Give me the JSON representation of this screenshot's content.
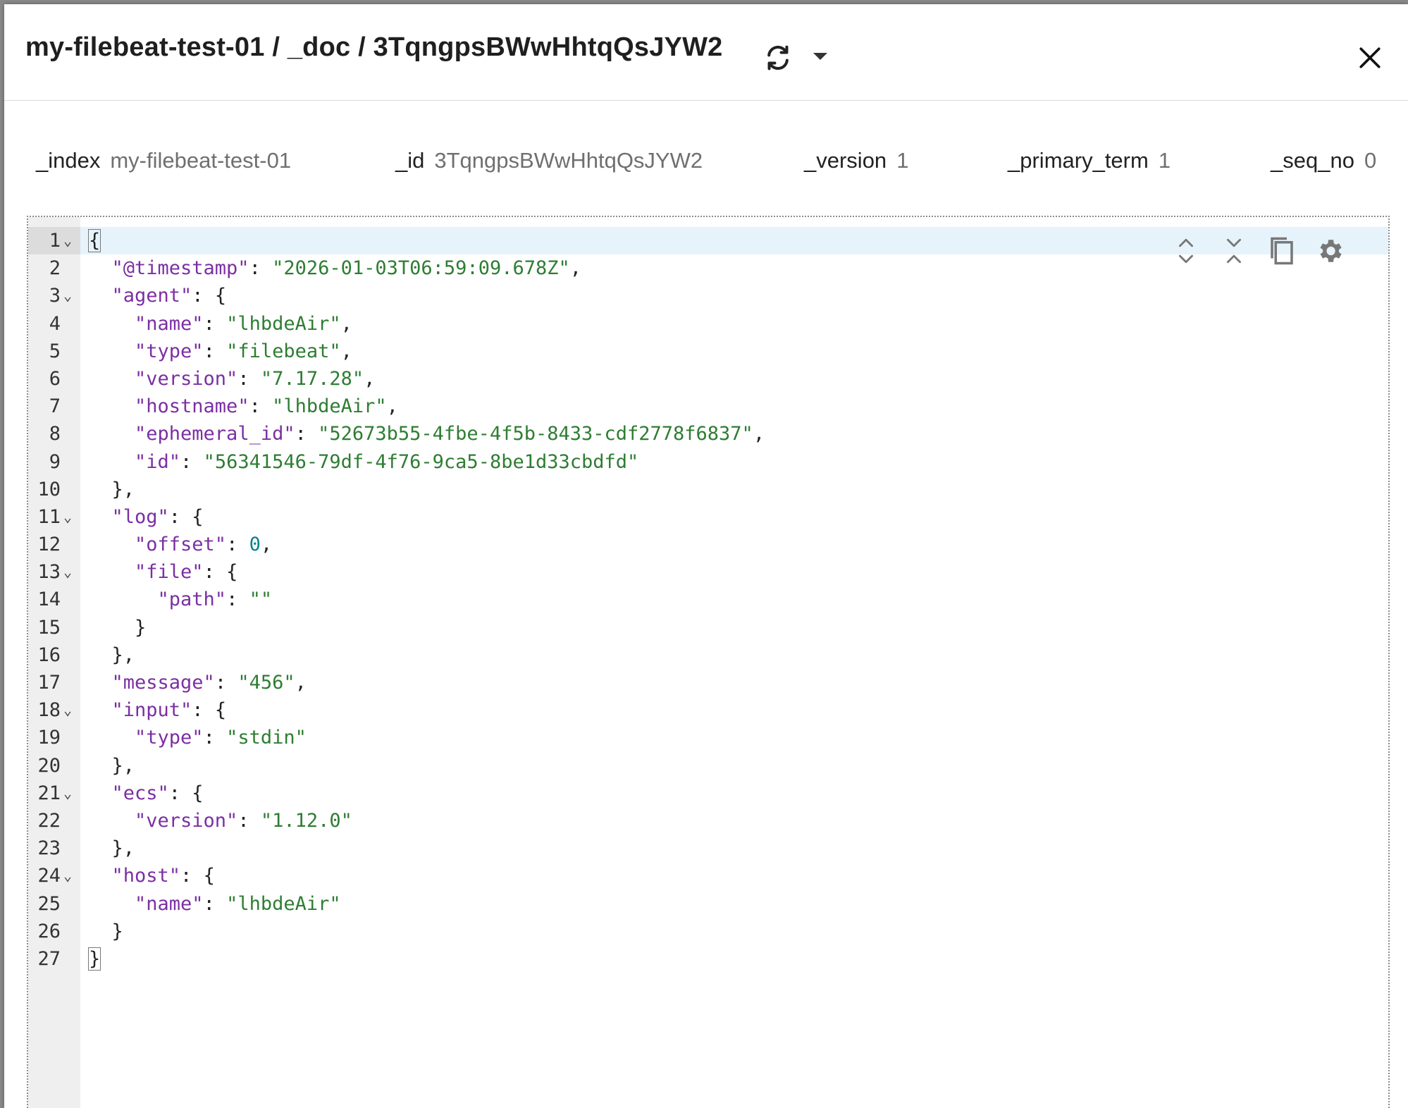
{
  "header": {
    "title": "my-filebeat-test-01 / _doc / 3TqngpsBWwHhtqQsJYW2",
    "refresh_icon": "refresh-icon",
    "dropdown_icon": "caret-down-icon",
    "close_icon": "close-icon"
  },
  "meta": [
    {
      "key": "_index",
      "value": "my-filebeat-test-01"
    },
    {
      "key": "_id",
      "value": "3TqngpsBWwHhtqQsJYW2"
    },
    {
      "key": "_version",
      "value": "1"
    },
    {
      "key": "_primary_term",
      "value": "1"
    },
    {
      "key": "_seq_no",
      "value": "0"
    }
  ],
  "editor": {
    "toolbar_icons": [
      "expand-all-icon",
      "collapse-all-icon",
      "copy-icon",
      "settings-icon"
    ],
    "colors": {
      "key": "#7b2fa3",
      "string": "#2e7d32",
      "number": "#00838f"
    },
    "lines": [
      {
        "n": "1",
        "fold": true,
        "indent": 0,
        "key": "",
        "sep": "",
        "val": "",
        "type": "",
        "tail": "{"
      },
      {
        "n": "2",
        "fold": false,
        "indent": 1,
        "key": "\"@timestamp\"",
        "sep": ": ",
        "val": "\"2026-01-03T06:59:09.678Z\"",
        "type": "s",
        "tail": ","
      },
      {
        "n": "3",
        "fold": true,
        "indent": 1,
        "key": "\"agent\"",
        "sep": ": ",
        "val": "",
        "type": "",
        "tail": "{"
      },
      {
        "n": "4",
        "fold": false,
        "indent": 2,
        "key": "\"name\"",
        "sep": ": ",
        "val": "\"lhbdeAir\"",
        "type": "s",
        "tail": ","
      },
      {
        "n": "5",
        "fold": false,
        "indent": 2,
        "key": "\"type\"",
        "sep": ": ",
        "val": "\"filebeat\"",
        "type": "s",
        "tail": ","
      },
      {
        "n": "6",
        "fold": false,
        "indent": 2,
        "key": "\"version\"",
        "sep": ": ",
        "val": "\"7.17.28\"",
        "type": "s",
        "tail": ","
      },
      {
        "n": "7",
        "fold": false,
        "indent": 2,
        "key": "\"hostname\"",
        "sep": ": ",
        "val": "\"lhbdeAir\"",
        "type": "s",
        "tail": ","
      },
      {
        "n": "8",
        "fold": false,
        "indent": 2,
        "key": "\"ephemeral_id\"",
        "sep": ": ",
        "val": "\"52673b55-4fbe-4f5b-8433-cdf2778f6837\"",
        "type": "s",
        "tail": ","
      },
      {
        "n": "9",
        "fold": false,
        "indent": 2,
        "key": "\"id\"",
        "sep": ": ",
        "val": "\"56341546-79df-4f76-9ca5-8be1d33cbdfd\"",
        "type": "s",
        "tail": ""
      },
      {
        "n": "10",
        "fold": false,
        "indent": 1,
        "key": "",
        "sep": "",
        "val": "",
        "type": "",
        "tail": "},"
      },
      {
        "n": "11",
        "fold": true,
        "indent": 1,
        "key": "\"log\"",
        "sep": ": ",
        "val": "",
        "type": "",
        "tail": "{"
      },
      {
        "n": "12",
        "fold": false,
        "indent": 2,
        "key": "\"offset\"",
        "sep": ": ",
        "val": "0",
        "type": "n",
        "tail": ","
      },
      {
        "n": "13",
        "fold": true,
        "indent": 2,
        "key": "\"file\"",
        "sep": ": ",
        "val": "",
        "type": "",
        "tail": "{"
      },
      {
        "n": "14",
        "fold": false,
        "indent": 3,
        "key": "\"path\"",
        "sep": ": ",
        "val": "\"\"",
        "type": "s",
        "tail": ""
      },
      {
        "n": "15",
        "fold": false,
        "indent": 2,
        "key": "",
        "sep": "",
        "val": "",
        "type": "",
        "tail": "}"
      },
      {
        "n": "16",
        "fold": false,
        "indent": 1,
        "key": "",
        "sep": "",
        "val": "",
        "type": "",
        "tail": "},"
      },
      {
        "n": "17",
        "fold": false,
        "indent": 1,
        "key": "\"message\"",
        "sep": ": ",
        "val": "\"456\"",
        "type": "s",
        "tail": ","
      },
      {
        "n": "18",
        "fold": true,
        "indent": 1,
        "key": "\"input\"",
        "sep": ": ",
        "val": "",
        "type": "",
        "tail": "{"
      },
      {
        "n": "19",
        "fold": false,
        "indent": 2,
        "key": "\"type\"",
        "sep": ": ",
        "val": "\"stdin\"",
        "type": "s",
        "tail": ""
      },
      {
        "n": "20",
        "fold": false,
        "indent": 1,
        "key": "",
        "sep": "",
        "val": "",
        "type": "",
        "tail": "},"
      },
      {
        "n": "21",
        "fold": true,
        "indent": 1,
        "key": "\"ecs\"",
        "sep": ": ",
        "val": "",
        "type": "",
        "tail": "{"
      },
      {
        "n": "22",
        "fold": false,
        "indent": 2,
        "key": "\"version\"",
        "sep": ": ",
        "val": "\"1.12.0\"",
        "type": "s",
        "tail": ""
      },
      {
        "n": "23",
        "fold": false,
        "indent": 1,
        "key": "",
        "sep": "",
        "val": "",
        "type": "",
        "tail": "},"
      },
      {
        "n": "24",
        "fold": true,
        "indent": 1,
        "key": "\"host\"",
        "sep": ": ",
        "val": "",
        "type": "",
        "tail": "{"
      },
      {
        "n": "25",
        "fold": false,
        "indent": 2,
        "key": "\"name\"",
        "sep": ": ",
        "val": "\"lhbdeAir\"",
        "type": "s",
        "tail": ""
      },
      {
        "n": "26",
        "fold": false,
        "indent": 1,
        "key": "",
        "sep": "",
        "val": "",
        "type": "",
        "tail": "}"
      },
      {
        "n": "27",
        "fold": false,
        "indent": 0,
        "key": "",
        "sep": "",
        "val": "",
        "type": "",
        "tail": "}"
      }
    ]
  }
}
